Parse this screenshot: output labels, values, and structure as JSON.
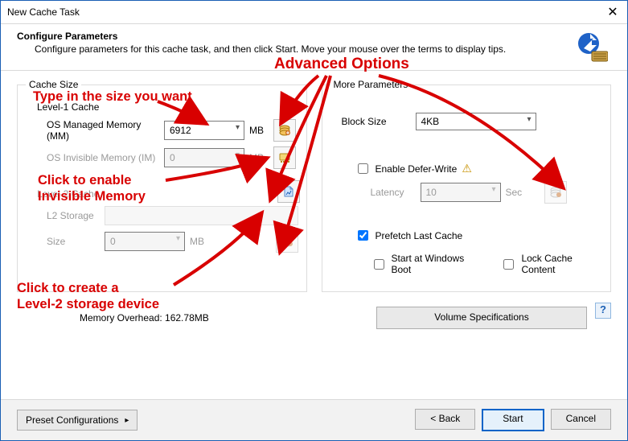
{
  "window": {
    "title": "New Cache Task"
  },
  "header": {
    "title": "Configure Parameters",
    "subtitle": "Configure parameters for this cache task, and then click Start. Move your mouse over the terms to display tips."
  },
  "annotations": {
    "advanced": "Advanced Options",
    "type_size": "Type in the size you want",
    "enable_im": "Click to enable\nInvisible Memory",
    "create_l2": "Click to create a\nLevel-2 storage device"
  },
  "cache_size": {
    "legend": "Cache Size",
    "level1_title": "Level-1 Cache",
    "mm_label": "OS Managed Memory (MM)",
    "mm_value": "6912",
    "mm_unit": "MB",
    "im_label": "OS Invisible Memory (IM)",
    "im_value": "0",
    "im_unit": "MB",
    "level2_title": "Level-2 Cache",
    "l2_storage_label": "L2 Storage",
    "l2_size_label": "Size",
    "l2_size_value": "0",
    "l2_size_unit": "MB"
  },
  "more": {
    "legend": "More Parameters",
    "block_label": "Block Size",
    "block_value": "4KB",
    "defer_label": "Enable Defer-Write",
    "latency_label": "Latency",
    "latency_value": "10",
    "latency_unit": "Sec",
    "prefetch_label": "Prefetch Last Cache",
    "start_boot_label": "Start at Windows Boot",
    "lock_label": "Lock Cache Content"
  },
  "overhead": "Memory Overhead: 162.78MB",
  "volume_btn": "Volume Specifications",
  "footer": {
    "preset": "Preset Configurations",
    "back": "< Back",
    "start": "Start",
    "cancel": "Cancel"
  }
}
